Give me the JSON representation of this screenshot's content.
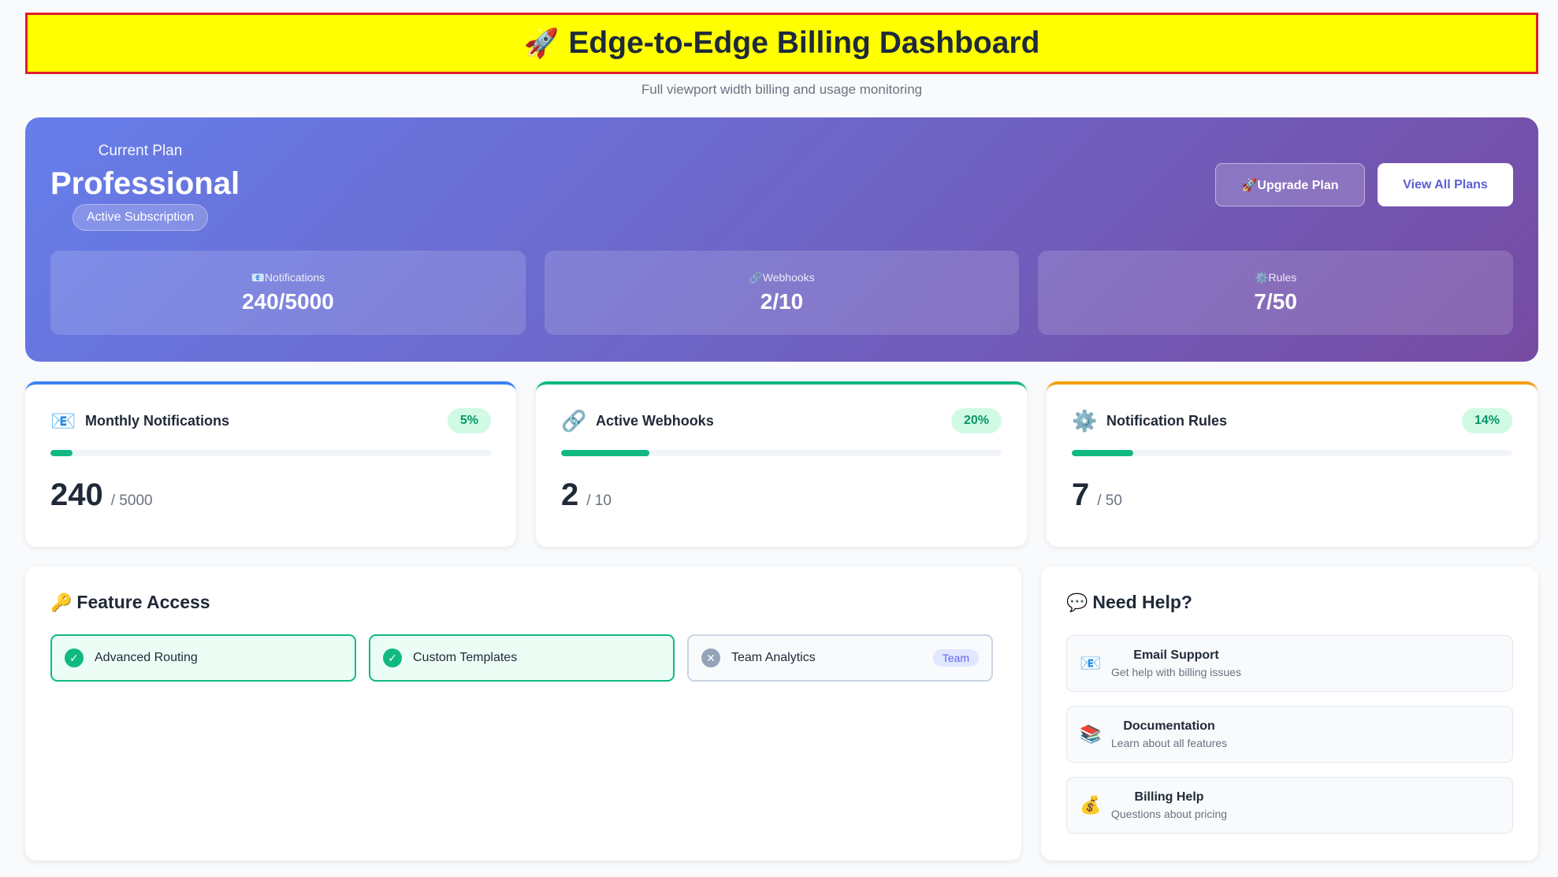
{
  "header": {
    "icon": "🚀",
    "title": "Edge-to-Edge Billing Dashboard",
    "subtitle": "Full viewport width billing and usage monitoring"
  },
  "plan": {
    "label": "Current Plan",
    "name": "Professional",
    "status": "Active Subscription",
    "upgrade_label": "🚀Upgrade Plan",
    "view_label": "View All Plans",
    "stats": [
      {
        "label": "📧Notifications",
        "value": "240/5000"
      },
      {
        "label": "🔗Webhooks",
        "value": "2/10"
      },
      {
        "label": "⚙️Rules",
        "value": "7/50"
      }
    ]
  },
  "usage": [
    {
      "icon": "📧",
      "title": "Monthly Notifications",
      "percent": "5%",
      "fill": 0.05,
      "used": "240",
      "max": "/ 5000",
      "accent": "#3b82f6"
    },
    {
      "icon": "🔗",
      "title": "Active Webhooks",
      "percent": "20%",
      "fill": 0.2,
      "used": "2",
      "max": "/ 10",
      "accent": "#10b981"
    },
    {
      "icon": "⚙️",
      "title": "Notification Rules",
      "percent": "14%",
      "fill": 0.14,
      "used": "7",
      "max": "/ 50",
      "accent": "#f59e0b"
    }
  ],
  "features": {
    "icon": "🔑",
    "title": "Feature Access",
    "items": [
      {
        "label": "Advanced Routing",
        "enabled": true,
        "icon": "✓"
      },
      {
        "label": "Custom Templates",
        "enabled": true,
        "icon": "✓"
      },
      {
        "label": "Team Analytics",
        "enabled": false,
        "icon": "✕",
        "badge": "Team"
      }
    ]
  },
  "help": {
    "icon": "💬",
    "title": "Need Help?",
    "items": [
      {
        "icon": "📧",
        "title": "Email Support",
        "desc": "Get help with billing issues"
      },
      {
        "icon": "📚",
        "title": "Documentation",
        "desc": "Learn about all features"
      },
      {
        "icon": "💰",
        "title": "Billing Help",
        "desc": "Questions about pricing"
      }
    ]
  }
}
